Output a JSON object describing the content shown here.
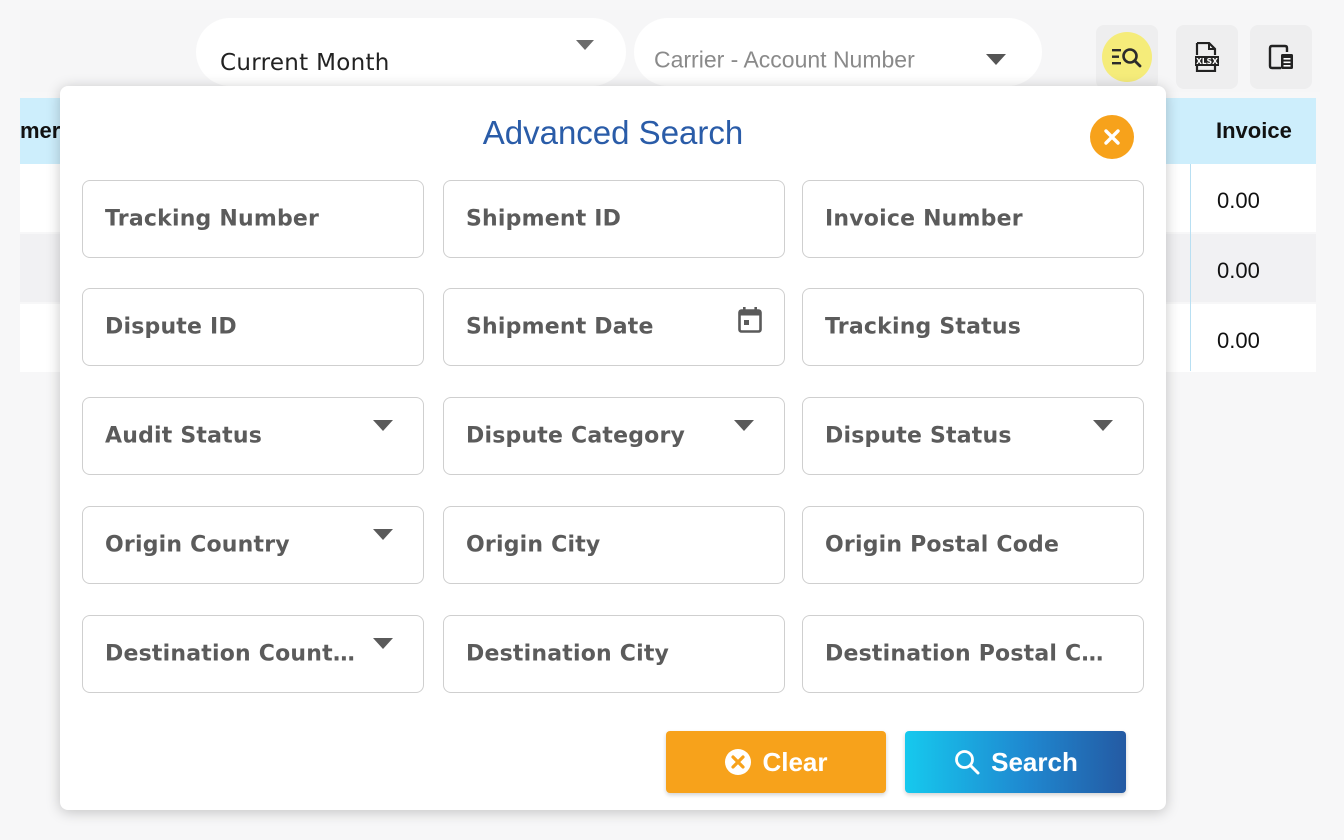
{
  "toolbar": {
    "period_select": {
      "value": "Current Month"
    },
    "carrier_select": {
      "placeholder": "Carrier - Account Number"
    },
    "tools": [
      {
        "icon": "advanced-search-icon",
        "active": true
      },
      {
        "icon": "xlsx-export-icon"
      },
      {
        "icon": "document-icon"
      }
    ]
  },
  "table": {
    "header_left": "mer",
    "header_right": "Invoice",
    "rows": [
      {
        "value": "0.00"
      },
      {
        "value": "0.00"
      },
      {
        "value": "0.00"
      }
    ]
  },
  "modal": {
    "title": "Advanced Search",
    "fields": [
      {
        "label": "Tracking Number",
        "type": "text"
      },
      {
        "label": "Shipment ID",
        "type": "text"
      },
      {
        "label": "Invoice Number",
        "type": "text"
      },
      {
        "label": "Dispute ID",
        "type": "text"
      },
      {
        "label": "Shipment Date",
        "type": "date"
      },
      {
        "label": "Tracking Status",
        "type": "text"
      },
      {
        "label": "Audit Status",
        "type": "select"
      },
      {
        "label": "Dispute Category",
        "type": "select"
      },
      {
        "label": "Dispute Status",
        "type": "select"
      },
      {
        "label": "Origin Country",
        "type": "select"
      },
      {
        "label": "Origin City",
        "type": "text"
      },
      {
        "label": "Origin Postal Code",
        "type": "text"
      },
      {
        "label": "Destination Count…",
        "type": "select"
      },
      {
        "label": "Destination City",
        "type": "text"
      },
      {
        "label": "Destination Postal C…",
        "type": "text"
      }
    ],
    "clear_label": "Clear",
    "search_label": "Search"
  },
  "colors": {
    "accent_orange": "#f7a21b",
    "title_blue": "#2a5ca8",
    "header_blue": "#cdeefc",
    "highlight_yellow": "#f5ec7a"
  }
}
